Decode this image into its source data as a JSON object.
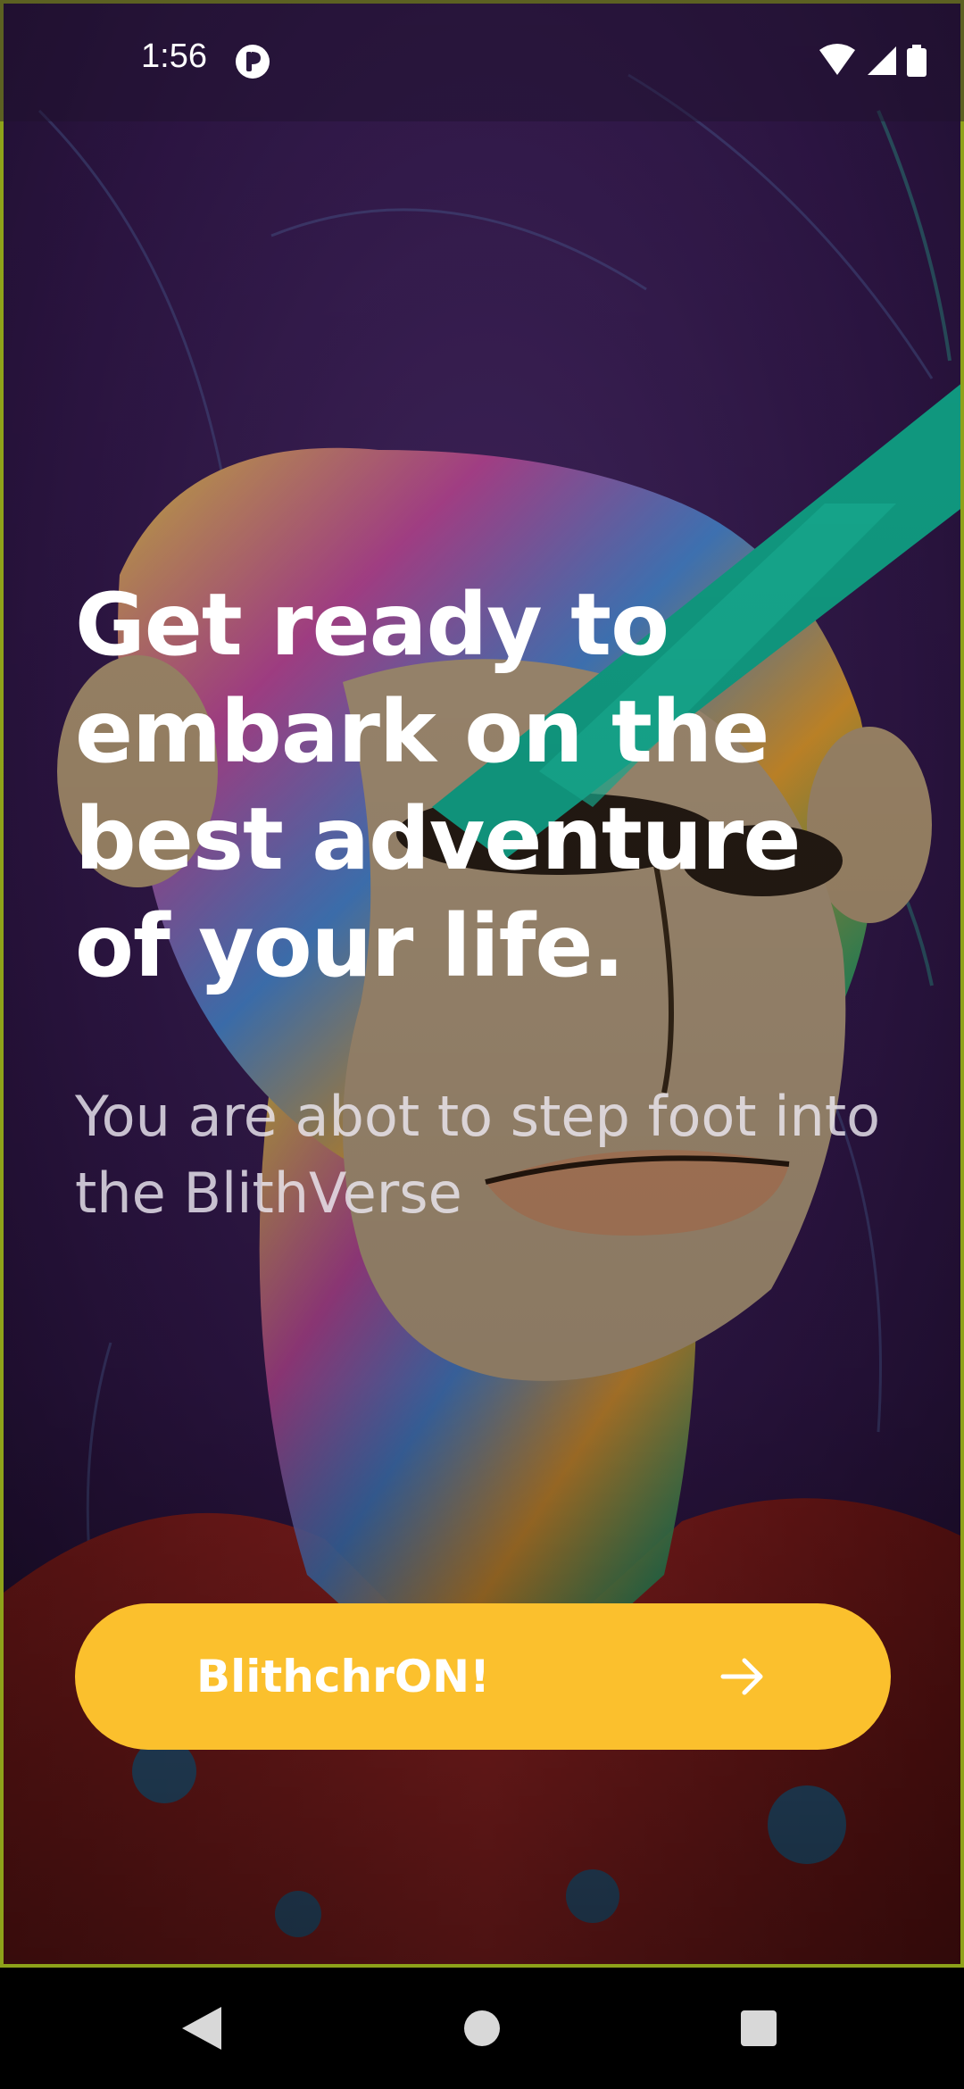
{
  "status_bar": {
    "time": "1:56",
    "icons": [
      "app-notification-icon",
      "wifi-icon",
      "cellular-signal-icon",
      "battery-icon"
    ]
  },
  "hero": {
    "headline": "Get ready to embark on the best adventure of your life.",
    "subtitle": "You are abot to step foot into the BlithVerse"
  },
  "cta": {
    "label": "BlithchrON!",
    "icon": "arrow-right-icon",
    "color": "#fbc02d"
  },
  "nav_bar": {
    "icons": [
      "back-triangle-icon",
      "home-circle-icon",
      "recents-square-icon"
    ]
  },
  "colors": {
    "accent": "#fbc02d",
    "background_purple": "#3a1f55",
    "teal_laser": "#14b89a",
    "text": "#ffffff"
  }
}
